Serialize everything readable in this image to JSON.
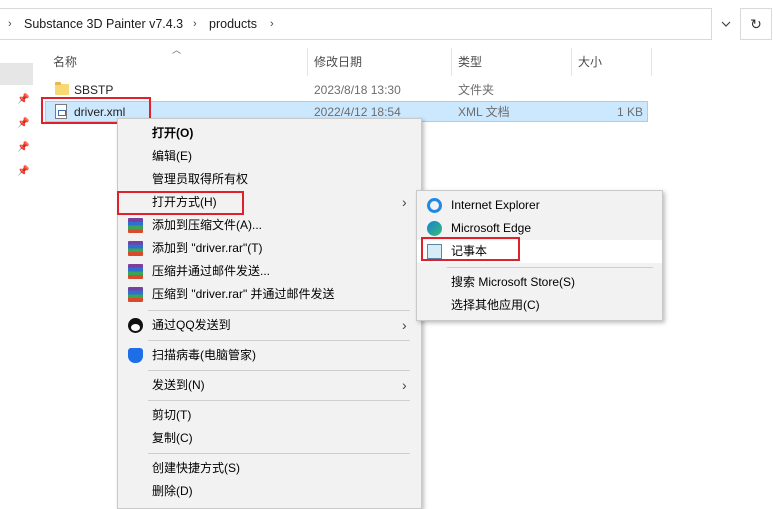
{
  "address_bar": {
    "crumbs": [
      "Substance 3D Painter v7.4.3",
      "products"
    ],
    "dropdown_icon": "chevron-down-icon",
    "refresh_icon": "refresh-icon"
  },
  "columns": {
    "name": "名称",
    "date": "修改日期",
    "type": "类型",
    "size": "大小"
  },
  "files": [
    {
      "name": "SBSTP",
      "date": "2023/8/18 13:30",
      "type": "文件夹",
      "size": "",
      "icon": "folder-icon"
    },
    {
      "name": "driver.xml",
      "date": "2022/4/12 18:54",
      "type": "XML 文档",
      "size": "1 KB",
      "icon": "xml-file-icon",
      "selected": true
    }
  ],
  "context_menu": {
    "open": "打开(O)",
    "edit": "编辑(E)",
    "take_ownership": "管理员取得所有权",
    "open_with": "打开方式(H)",
    "add_to_archive": "添加到压缩文件(A)...",
    "add_to_rar": "添加到 \"driver.rar\"(T)",
    "compress_email": "压缩并通过邮件发送...",
    "compress_rar_email": "压缩到 \"driver.rar\" 并通过邮件发送",
    "send_via_qq": "通过QQ发送到",
    "scan_virus": "扫描病毒(电脑管家)",
    "send_to": "发送到(N)",
    "cut": "剪切(T)",
    "copy": "复制(C)",
    "create_shortcut": "创建快捷方式(S)",
    "delete": "删除(D)"
  },
  "open_with_submenu": {
    "ie": "Internet Explorer",
    "edge": "Microsoft Edge",
    "notepad": "记事本",
    "store": "搜索 Microsoft Store(S)",
    "other": "选择其他应用(C)"
  },
  "colors": {
    "selection_bg": "#cce8ff",
    "annotation_red": "#e0202a",
    "menu_bg": "#f2f2f2"
  }
}
